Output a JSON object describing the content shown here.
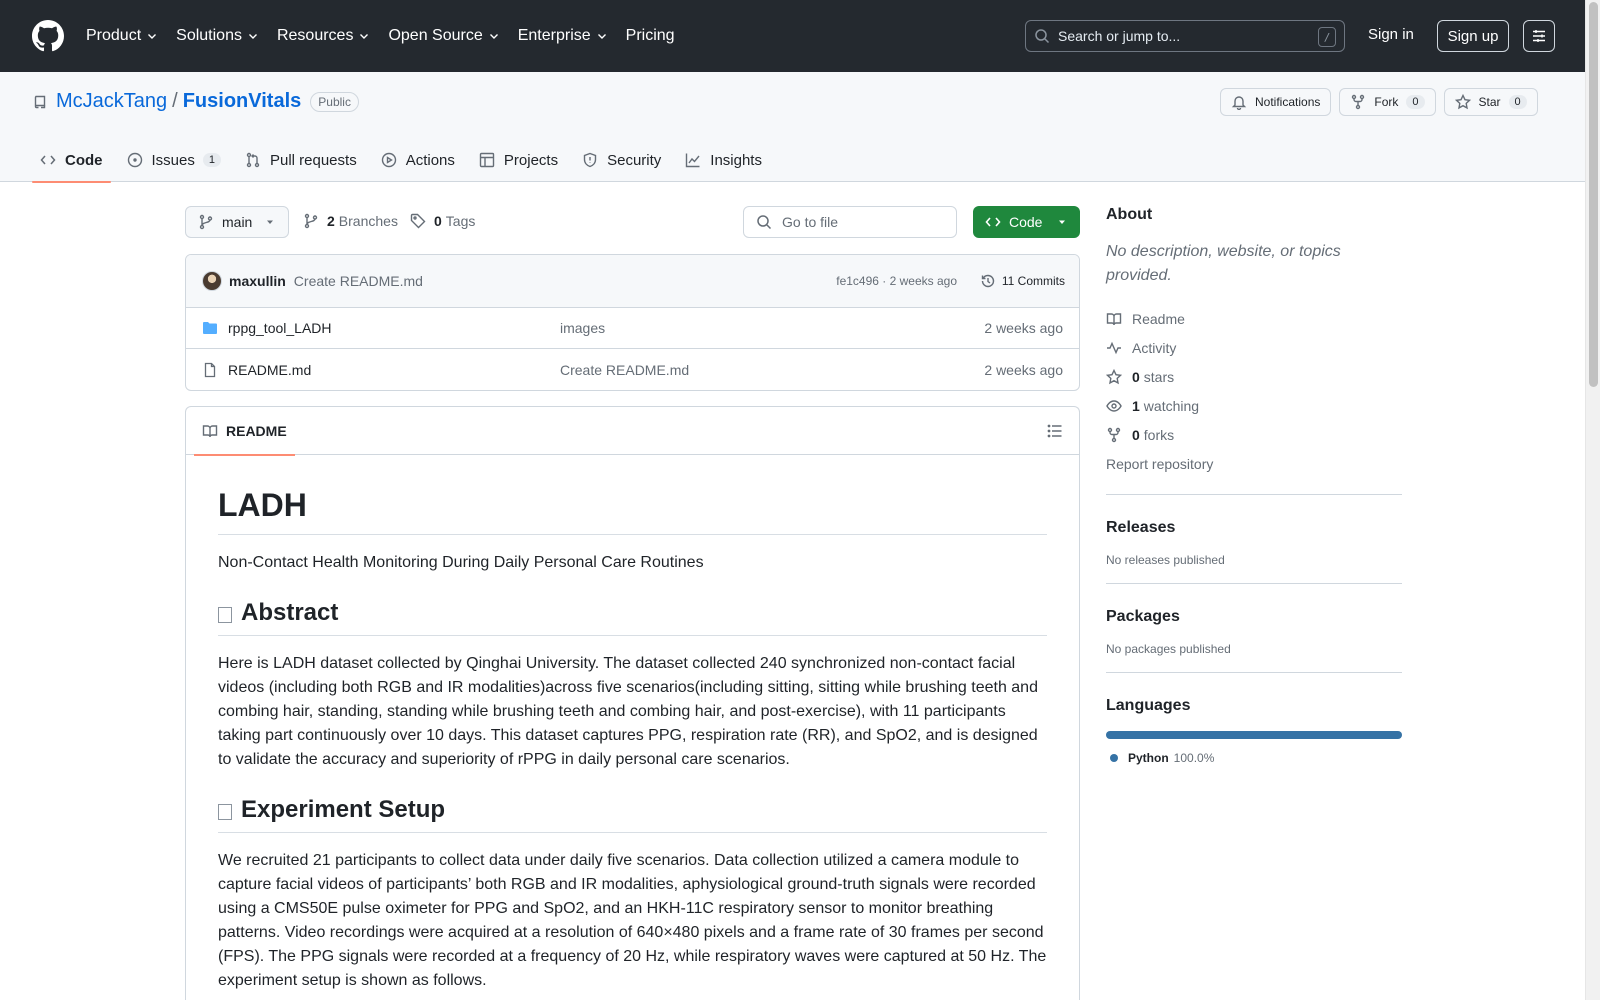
{
  "header": {
    "nav": [
      "Product",
      "Solutions",
      "Resources",
      "Open Source",
      "Enterprise",
      "Pricing"
    ],
    "search_placeholder": "Search or jump to...",
    "search_key": "/",
    "sign_in": "Sign in",
    "sign_up": "Sign up"
  },
  "repo": {
    "owner": "McJackTang",
    "separator": "/",
    "name": "FusionVitals",
    "visibility": "Public",
    "notifications": "Notifications",
    "fork_label": "Fork",
    "fork_count": "0",
    "star_label": "Star",
    "star_count": "0"
  },
  "tabs": {
    "code": "Code",
    "issues": "Issues",
    "issues_count": "1",
    "pulls": "Pull requests",
    "actions": "Actions",
    "projects": "Projects",
    "security": "Security",
    "insights": "Insights"
  },
  "filebar": {
    "branch": "main",
    "branches_count": "2",
    "branches_label": "Branches",
    "tags_count": "0",
    "tags_label": "Tags",
    "goto_placeholder": "Go to file",
    "code_button": "Code"
  },
  "commit": {
    "author": "maxullin",
    "message": "Create README.md",
    "hash_time": "fe1c496 · 2 weeks ago",
    "commits": "11 Commits"
  },
  "files": [
    {
      "name": "rppg_tool_LADH",
      "message": "images",
      "date": "2 weeks ago",
      "type": "folder"
    },
    {
      "name": "README.md",
      "message": "Create README.md",
      "date": "2 weeks ago",
      "type": "file"
    }
  ],
  "readme": {
    "tab_label": "README",
    "title": "LADH",
    "subtitle": "Non-Contact Health Monitoring During Daily Personal Care Routines",
    "abstract_heading": "Abstract",
    "abstract_text": "Here is LADH dataset collected by Qinghai University. The dataset collected 240 synchronized non-contact facial videos (including both RGB and IR modalities)across five scenarios(including sitting, sitting while brushing teeth and combing hair, standing, standing while brushing teeth and combing hair, and post-exercise), with 11 participants taking part continuously over 10 days. This dataset captures PPG, respiration rate (RR), and SpO2, and is designed to validate the accuracy and superiority of rPPG in daily personal care scenarios.",
    "setup_heading": "Experiment Setup",
    "setup_text": "We recruited 21 participants to collect data under daily five scenarios. Data collection utilized a camera module to capture facial videos of participants’ both RGB and IR modalities, aphysiological ground-truth signals were recorded using a CMS50E pulse oximeter for PPG and SpO2, and an HKH-11C respiratory sensor to monitor breathing patterns. Video recordings were acquired at a resolution of 640×480 pixels and a frame rate of 30 frames per second (FPS). The PPG signals were recorded at a frequency of 20 Hz, while respiratory waves were captured at 50 Hz. The experiment setup is shown as follows."
  },
  "sidebar": {
    "about_heading": "About",
    "about_desc": "No description, website, or topics provided.",
    "readme": "Readme",
    "activity": "Activity",
    "stars_count": "0",
    "stars_label": "stars",
    "watching_count": "1",
    "watching_label": "watching",
    "forks_count": "0",
    "forks_label": "forks",
    "report": "Report repository",
    "releases_heading": "Releases",
    "releases_text": "No releases published",
    "packages_heading": "Packages",
    "packages_text": "No packages published",
    "languages_heading": "Languages",
    "language_name": "Python",
    "language_pct": "100.0%",
    "language_color": "#3572A5"
  }
}
